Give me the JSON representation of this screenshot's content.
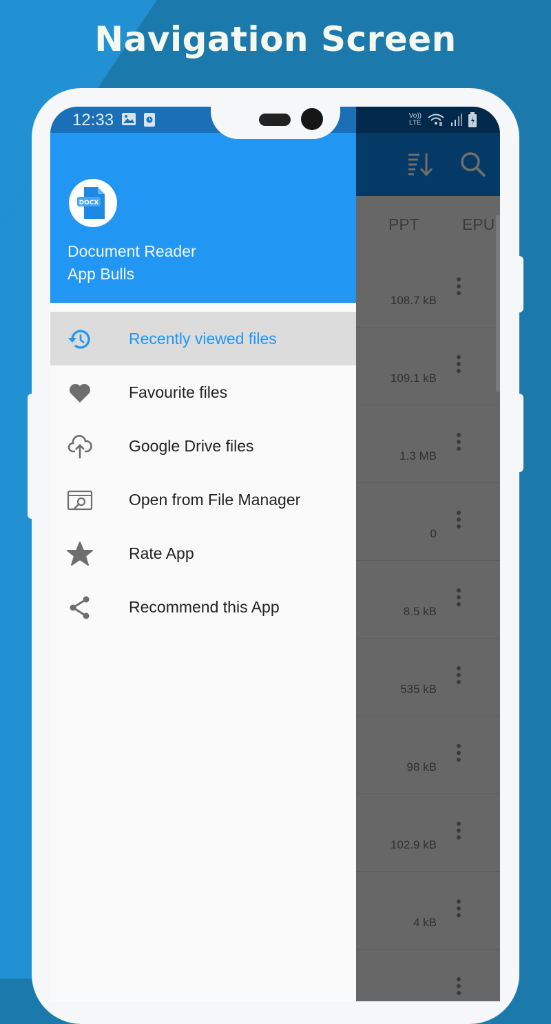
{
  "headline": "Navigation Screen",
  "status_bar": {
    "time": "12:33",
    "left_icons": [
      "image-icon",
      "clock-notification-icon"
    ],
    "right_icons": [
      "volte-icon",
      "wifi-icon",
      "signal-icon",
      "battery-charging-icon"
    ],
    "volte_top": "Vo))",
    "volte_bottom": "LTE"
  },
  "toolbar": {
    "icons": [
      "sort-icon",
      "search-icon"
    ]
  },
  "tabs": [
    {
      "label": "PPT"
    },
    {
      "label": "EPUB"
    }
  ],
  "drawer": {
    "logo_text": "DOCX",
    "app_name_line1": "Document Reader",
    "app_name_line2": "App Bulls",
    "accent_color": "#2196f3",
    "items": [
      {
        "label": "Recently viewed files",
        "icon": "history-icon",
        "active": true
      },
      {
        "label": "Favourite files",
        "icon": "heart-icon",
        "active": false
      },
      {
        "label": "Google Drive files",
        "icon": "cloud-upload-icon",
        "active": false
      },
      {
        "label": "Open from File Manager",
        "icon": "file-manager-search-icon",
        "active": false
      },
      {
        "label": "Rate App",
        "icon": "star-icon",
        "active": false
      },
      {
        "label": "Recommend this App",
        "icon": "share-icon",
        "active": false
      }
    ]
  },
  "file_list": {
    "sizes": [
      "108.7 kB",
      "109.1 kB",
      "1.3 MB",
      "0",
      "8.5 kB",
      "535 kB",
      "98 kB",
      "102.9 kB",
      "4 kB",
      ""
    ]
  }
}
